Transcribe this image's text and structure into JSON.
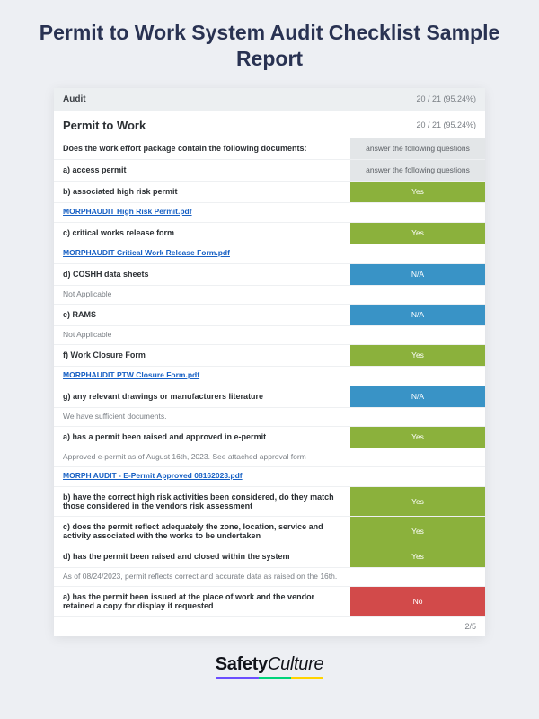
{
  "page_title": "Permit to Work System Audit Checklist Sample Report",
  "audit": {
    "label": "Audit",
    "score": "20 / 21 (95.24%)"
  },
  "section": {
    "title": "Permit to Work",
    "score": "20 / 21 (95.24%)"
  },
  "answers": {
    "instruct": "answer the following questions",
    "yes": "Yes",
    "na": "N/A",
    "no": "No"
  },
  "rows": [
    {
      "q": "Does the work effort package contain the following documents:",
      "ans_key": "instruct",
      "ans_style": "gray"
    },
    {
      "q": "a)  access permit",
      "ans_key": "instruct",
      "ans_style": "gray"
    },
    {
      "q": "b)  associated high risk permit",
      "ans_key": "yes",
      "ans_style": "green"
    },
    {
      "attach": "MORPHAUDIT High Risk Permit.pdf"
    },
    {
      "q": "c)  critical works release form",
      "ans_key": "yes",
      "ans_style": "green"
    },
    {
      "attach": "MORPHAUDIT Critical Work Release Form.pdf"
    },
    {
      "q": "d)  COSHH data sheets",
      "ans_key": "na",
      "ans_style": "blue"
    },
    {
      "note": "Not Applicable"
    },
    {
      "q": "e) RAMS",
      "ans_key": "na",
      "ans_style": "blue"
    },
    {
      "note": "Not Applicable"
    },
    {
      "q": "f) Work Closure Form",
      "ans_key": "yes",
      "ans_style": "green"
    },
    {
      "attach": "MORPHAUDIT PTW Closure Form.pdf"
    },
    {
      "q": "g) any relevant drawings or manufacturers literature",
      "ans_key": "na",
      "ans_style": "blue"
    },
    {
      "note": "We have sufficient documents."
    },
    {
      "q": "a) has a permit been raised and approved in e-permit",
      "ans_key": "yes",
      "ans_style": "green"
    },
    {
      "note": "Approved e-permit as of August 16th, 2023. See attached approval form"
    },
    {
      "attach": "MORPH AUDIT - E-Permit Approved 08162023.pdf"
    },
    {
      "q": "b)  have the correct high risk activities been considered, do they match those considered in the vendors risk assessment",
      "ans_key": "yes",
      "ans_style": "green"
    },
    {
      "q": "c)  does the permit reflect adequately the zone, location, service and activity associated with the works to be undertaken",
      "ans_key": "yes",
      "ans_style": "green"
    },
    {
      "q": "d)  has the permit been raised and closed within the system",
      "ans_key": "yes",
      "ans_style": "green"
    },
    {
      "note": "As of 08/24/2023, permit reflects correct and accurate data as raised on the 16th."
    },
    {
      "q": "a)  has the permit been issued at the place of work and the vendor retained a copy for display if requested",
      "ans_key": "no",
      "ans_style": "red"
    }
  ],
  "pager": "2/5",
  "brand": {
    "part1": "Safety",
    "part2": "Culture"
  }
}
